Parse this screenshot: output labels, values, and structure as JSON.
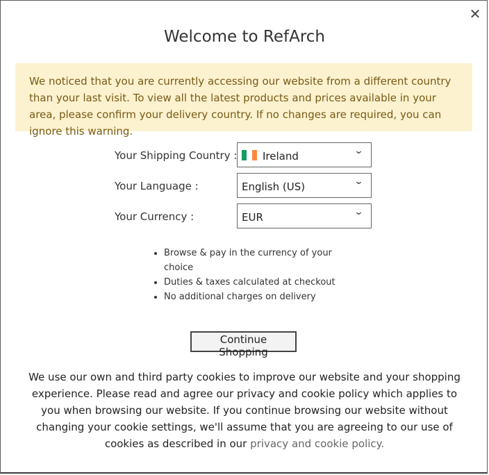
{
  "dialog": {
    "title": "Welcome to RefArch",
    "close_label": "✕",
    "warning": "We noticed that you are currently accessing our website from a different country than your last visit. To view all the latest products and prices available in your area, please confirm your delivery country. If no changes are required, you can ignore this warning."
  },
  "form": {
    "shipping_label": "Your Shipping Country :",
    "shipping_value": "Ireland",
    "language_label": "Your Language :",
    "language_value": "English (US)",
    "currency_label": "Your Currency :",
    "currency_value": "EUR",
    "chevron": "⌄"
  },
  "flag_colors": [
    "#169b62",
    "#ffffff",
    "#ff883e"
  ],
  "benefits": [
    "Browse & pay in the currency of your choice",
    "Duties & taxes calculated at checkout",
    "No additional charges on delivery"
  ],
  "continue_button": "Continue Shopping",
  "cookie": {
    "text": "We use our own and third party cookies to improve our website and your shopping experience. Please read and agree our privacy and cookie policy which applies to you when browsing our website. If you continue browsing our website without changing your cookie settings, we'll assume that you are agreeing to our use of cookies as described in our ",
    "link": "privacy and cookie policy."
  }
}
